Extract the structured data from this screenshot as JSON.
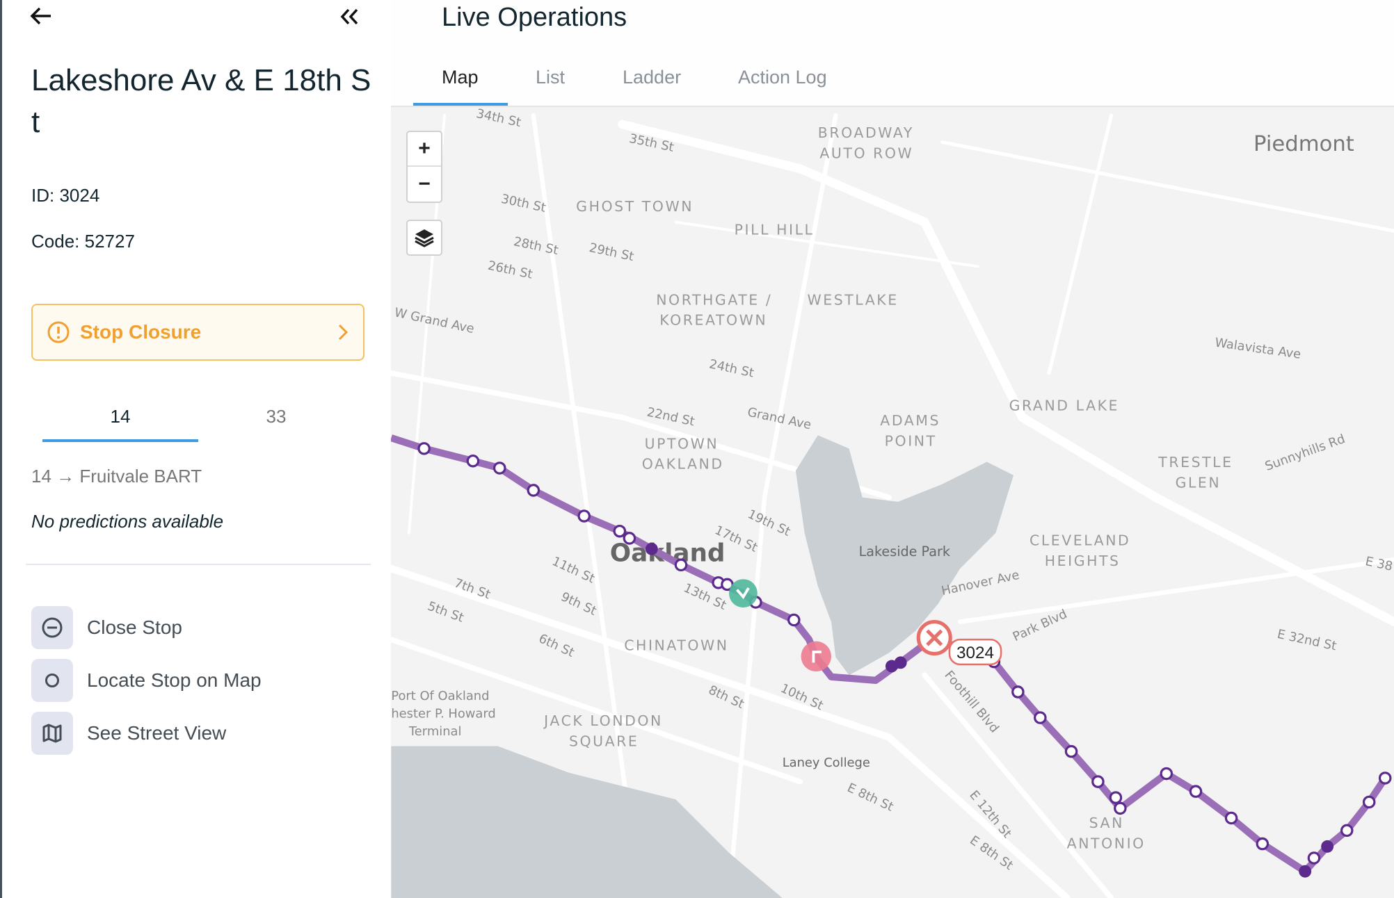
{
  "panel": {
    "back_icon": "arrow-left-icon",
    "collapse_icon": "double-chevron-left-icon",
    "title": "Lakeshore Av & E 18th St",
    "id_text": "ID: 3024",
    "code_text": "Code: 52727",
    "alert": {
      "label": "Stop Closure",
      "icon": "exclamation-circle-icon",
      "color": "#f0a030"
    },
    "route_tabs": [
      {
        "label": "14",
        "active": true
      },
      {
        "label": "33",
        "active": false
      }
    ],
    "route_direction": "14 → Fruitvale BART",
    "predictions": "No predictions available",
    "actions": [
      {
        "label": "Close Stop",
        "icon": "minus-circle-icon"
      },
      {
        "label": "Locate Stop on Map",
        "icon": "circle-icon"
      },
      {
        "label": "See Street View",
        "icon": "map-icon"
      }
    ]
  },
  "header": {
    "title": "Live Operations",
    "tabs": [
      {
        "label": "Map",
        "active": true
      },
      {
        "label": "List"
      },
      {
        "label": "Ladder"
      },
      {
        "label": "Action Log"
      }
    ],
    "accent": "#3d9be0"
  },
  "map": {
    "zoom_in": "+",
    "zoom_out": "−",
    "route_color": "#9b6fb8",
    "selected_stop_label": "3024",
    "labels": {
      "piedmont": "Piedmont",
      "oakland": "Oakland",
      "broadway": "BROADWAY",
      "autorow": "AUTO ROW",
      "ghost": "GHOST TOWN",
      "pill": "PILL HILL",
      "northgate": "NORTHGATE /",
      "koreatown": "KOREATOWN",
      "westlake": "WESTLAKE",
      "uptown": "UPTOWN",
      "uoak": "OAKLAND",
      "adams": "ADAMS",
      "point": "POINT",
      "grandlake": "GRAND LAKE",
      "trestle": "TRESTLE",
      "glen": "GLEN",
      "cleveland": "CLEVELAND",
      "heights": "HEIGHTS",
      "chinatown": "CHINATOWN",
      "jack": "JACK LONDON",
      "square": "SQUARE",
      "san": "SAN",
      "antonio": "ANTONIO",
      "lakeside": "Lakeside Park",
      "laney": "Laney College",
      "port1": "Port Of Oakland",
      "port2": "hester P. Howard",
      "port3": "Terminal",
      "s35": "35th St",
      "s34": "34th St",
      "s30": "30th St",
      "s28": "28th St",
      "s29": "29th St",
      "s26": "26th St",
      "s24": "24th St",
      "s22": "22nd St",
      "grand": "Grand Ave",
      "wgrand": "W Grand Ave",
      "s19": "19th St",
      "s17": "17th St",
      "s11": "11th St",
      "s13": "13th St",
      "s9": "9th St",
      "s7": "7th St",
      "s5": "5th St",
      "s6": "6th St",
      "s8": "8th St",
      "s10": "10th St",
      "hanover": "Hanover Ave",
      "park": "Park Blvd",
      "foothill": "Foothill Blvd",
      "e8": "E 8th St",
      "e12": "E 12th St",
      "e8b": "E 8th St",
      "walavista": "Walavista Ave",
      "sunny": "Sunnyhills Rd",
      "e32": "E 32nd St",
      "e38": "E 38"
    }
  }
}
